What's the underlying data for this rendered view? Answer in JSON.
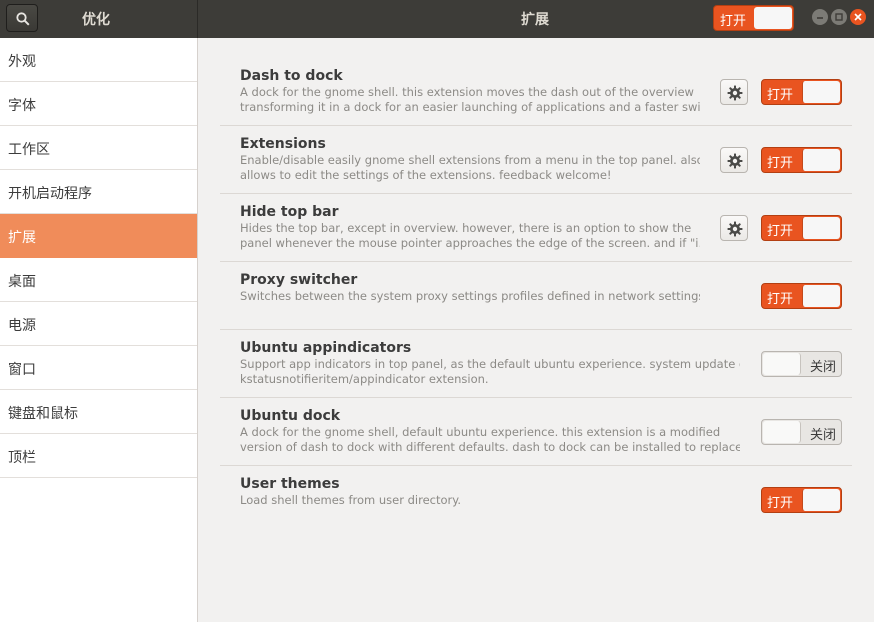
{
  "header": {
    "app_title": "优化",
    "page_title": "扩展",
    "global_switch": {
      "label": "打开",
      "state": "on"
    },
    "search_icon": "search-icon",
    "window_controls": [
      "minimize-icon",
      "maximize-icon",
      "close-icon"
    ]
  },
  "sidebar": {
    "items": [
      {
        "label": "外观"
      },
      {
        "label": "字体"
      },
      {
        "label": "工作区"
      },
      {
        "label": "开机启动程序"
      },
      {
        "label": "扩展",
        "active": true
      },
      {
        "label": "桌面"
      },
      {
        "label": "电源"
      },
      {
        "label": "窗口"
      },
      {
        "label": "键盘和鼠标"
      },
      {
        "label": "顶栏"
      }
    ]
  },
  "extensions": [
    {
      "title": "Dash to dock",
      "desc1": "A dock for the gnome shell. this extension moves the dash out of the overview",
      "desc2": "transforming it in a dock for an easier launching of applications and a faster swit…",
      "has_settings": true,
      "switch_label": "打开",
      "state": "on"
    },
    {
      "title": "Extensions",
      "desc1": "Enable/disable easily gnome shell extensions from a menu in the top panel. also",
      "desc2": "allows to edit the settings of the extensions. feedback welcome!",
      "has_settings": true,
      "switch_label": "打开",
      "state": "on"
    },
    {
      "title": "Hide top bar",
      "desc1": "Hides the top bar, except in overview. however, there is an option to show the",
      "desc2": "panel whenever the mouse pointer approaches the edge of the screen. and if \"i…",
      "has_settings": true,
      "switch_label": "打开",
      "state": "on"
    },
    {
      "title": "Proxy switcher",
      "desc1": "Switches between the system proxy settings profiles defined in network settings.",
      "desc2": "",
      "has_settings": false,
      "switch_label": "打开",
      "state": "on"
    },
    {
      "title": "Ubuntu appindicators",
      "desc1": "Support app indicators in top panel, as the default ubuntu experience. system update of",
      "desc2": "kstatusnotifieritem/appindicator extension.",
      "has_settings": false,
      "switch_label": "关闭",
      "state": "off"
    },
    {
      "title": "Ubuntu dock",
      "desc1": "A dock for the gnome shell, default ubuntu experience. this extension is a modified",
      "desc2": "version of dash to dock with different defaults. dash to dock can be installed to replace i…",
      "has_settings": false,
      "switch_label": "关闭",
      "state": "off"
    },
    {
      "title": "User themes",
      "desc1": "Load shell themes from user directory.",
      "desc2": "",
      "has_settings": false,
      "switch_label": "打开",
      "state": "on"
    }
  ],
  "colors": {
    "accent": "#e95420",
    "sidebar_active": "#f08c5a",
    "header_bg": "#3d3c38"
  }
}
